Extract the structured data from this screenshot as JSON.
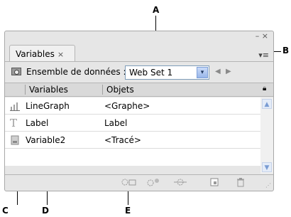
{
  "callouts": {
    "a": "A",
    "b": "B",
    "c": "C",
    "d": "D",
    "e": "E"
  },
  "panel": {
    "tab_label": "Variables",
    "tab_close": "×",
    "window_minimize": "–",
    "window_close": "×",
    "menu_icon": "▾≡",
    "dataset_label": "Ensemble de données :",
    "dataset_value": "Web Set 1",
    "dropdown_arrow": "▾",
    "prev_symbol": "◀",
    "next_symbol": "▶"
  },
  "table": {
    "col_variables": "Variables",
    "col_objects": "Objets",
    "rows": [
      {
        "icon": "graph-variable-icon",
        "name": "LineGraph",
        "object": "<Graphe>"
      },
      {
        "icon": "text-variable-icon",
        "name": "Label",
        "object": "Label"
      },
      {
        "icon": "visibility-variable-icon",
        "name": "Variable2",
        "object": "<Tracé>"
      }
    ]
  },
  "bottom_icons": [
    "capture-dataset-icon",
    "bind-object-icon",
    "unbind-variable-icon",
    "new-variable-icon",
    "delete-variable-icon"
  ]
}
